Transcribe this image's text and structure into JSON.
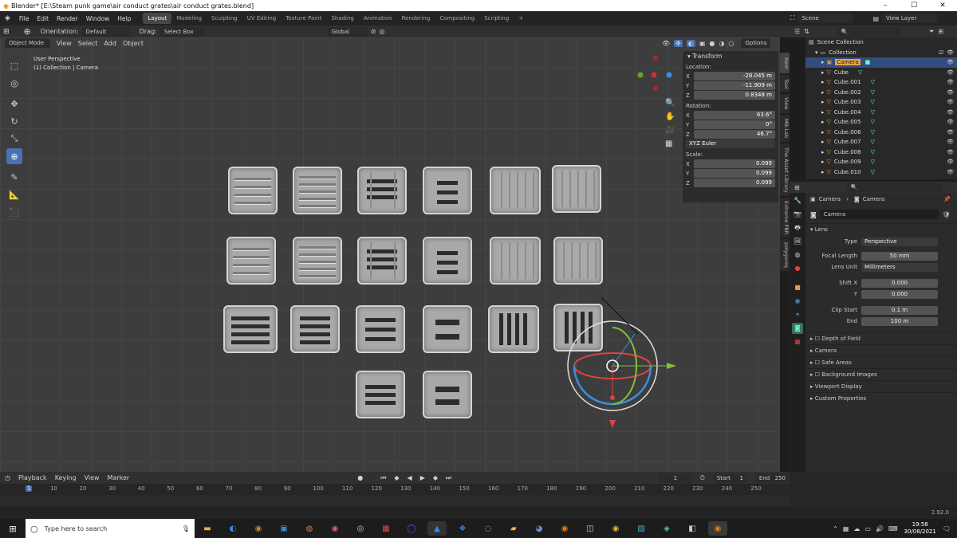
{
  "window": {
    "title": "Blender* [E:\\Steam punk game\\air conduct grates\\air conduct grates.blend]",
    "min": "–",
    "max": "☐",
    "close": "✕"
  },
  "menus": [
    "File",
    "Edit",
    "Render",
    "Window",
    "Help"
  ],
  "workspaces": [
    "Layout",
    "Modeling",
    "Sculpting",
    "UV Editing",
    "Texture Paint",
    "Shading",
    "Animation",
    "Rendering",
    "Compositing",
    "Scripting"
  ],
  "add_workspace": "+",
  "scene": {
    "label": "Scene",
    "view_layer": "View Layer"
  },
  "header": {
    "mode": "Object Mode",
    "menus": [
      "View",
      "Select",
      "Add",
      "Object"
    ],
    "orientation_label": "Orientation:",
    "orientation_value": "Default",
    "drag_label": "Drag:",
    "drag_value": "Select Box",
    "transform": "Global",
    "options": "Options"
  },
  "viewport": {
    "view_name": "User Perspective",
    "collection_info": "(1) Collection | Camera"
  },
  "transform": {
    "title": "Transform",
    "location_label": "Location:",
    "location": {
      "x": "-28.045 m",
      "y": "-11.909 m",
      "z": "0.8348 m"
    },
    "rotation_label": "Rotation:",
    "rotation": {
      "x": "63.6°",
      "y": "0°",
      "z": "46.7°"
    },
    "rotation_mode": "XYZ Euler",
    "scale_label": "Scale:",
    "scale": {
      "x": "0.099",
      "y": "0.099",
      "z": "0.099"
    }
  },
  "axis_labels": {
    "x": "X",
    "y": "Y",
    "z": "Z"
  },
  "side_tabs": [
    "Item",
    "Tool",
    "View",
    "MB-Lab",
    "The Asset Library",
    "Extreme PBR",
    "polygoniq"
  ],
  "outliner": {
    "root": "Scene Collection",
    "collection": "Collection",
    "items": [
      "Camera",
      "Cube",
      "Cube.001",
      "Cube.002",
      "Cube.003",
      "Cube.004",
      "Cube.005",
      "Cube.006",
      "Cube.007",
      "Cube.008",
      "Cube.009",
      "Cube.010"
    ]
  },
  "properties": {
    "breadcrumb_a": "Camera",
    "breadcrumb_b": "Camera",
    "data_name": "Camera",
    "lens_section": "Lens",
    "type_label": "Type",
    "type_value": "Perspective",
    "focal_label": "Focal Length",
    "focal_value": "50 mm",
    "lens_unit_label": "Lens Unit",
    "lens_unit_value": "Millimeters",
    "shiftx_label": "Shift X",
    "shiftx_value": "0.000",
    "shifty_label": "Y",
    "shifty_value": "0.000",
    "clipstart_label": "Clip Start",
    "clipstart_value": "0.1 m",
    "clipend_label": "End",
    "clipend_value": "100 m",
    "sections": [
      "Depth of Field",
      "Camera",
      "Safe Areas",
      "Background Images",
      "Viewport Display",
      "Custom Properties"
    ]
  },
  "timeline": {
    "menus": [
      "Playback",
      "Keying",
      "View",
      "Marker"
    ],
    "current_frame": "1",
    "start_label": "Start",
    "start": "1",
    "end_label": "End",
    "end": "250",
    "ticks": [
      "1",
      "10",
      "20",
      "30",
      "40",
      "50",
      "60",
      "70",
      "80",
      "90",
      "100",
      "110",
      "120",
      "130",
      "140",
      "150",
      "160",
      "170",
      "180",
      "190",
      "200",
      "210",
      "220",
      "230",
      "240",
      "250"
    ]
  },
  "status": {
    "version": "2.92.0"
  },
  "taskbar": {
    "search_placeholder": "Type here to search",
    "time": "19:58",
    "date": "30/08/2021"
  },
  "colors": {
    "accent": "#4772b3",
    "selected": "#334d80",
    "x_axis": "#e44b4b",
    "y_axis": "#7cc23a",
    "z_axis": "#3b8de0"
  }
}
